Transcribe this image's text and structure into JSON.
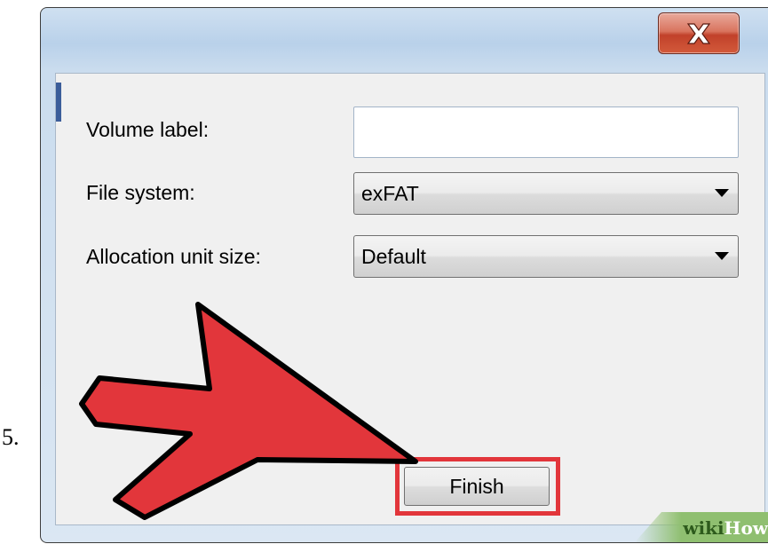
{
  "step": {
    "number": "5."
  },
  "window": {
    "close_icon": "close-x-icon"
  },
  "form": {
    "volume_label": {
      "label": "Volume label:",
      "value": ""
    },
    "file_system": {
      "label": "File system:",
      "selected": "exFAT"
    },
    "allocation_unit_size": {
      "label": "Allocation unit size:",
      "selected": "Default"
    }
  },
  "buttons": {
    "finish_label": "Finish"
  },
  "annotation": {
    "arrow_color": "#e2363b",
    "highlight_color": "#e2363b"
  },
  "watermark": {
    "wiki": "wiki",
    "how": "How"
  }
}
